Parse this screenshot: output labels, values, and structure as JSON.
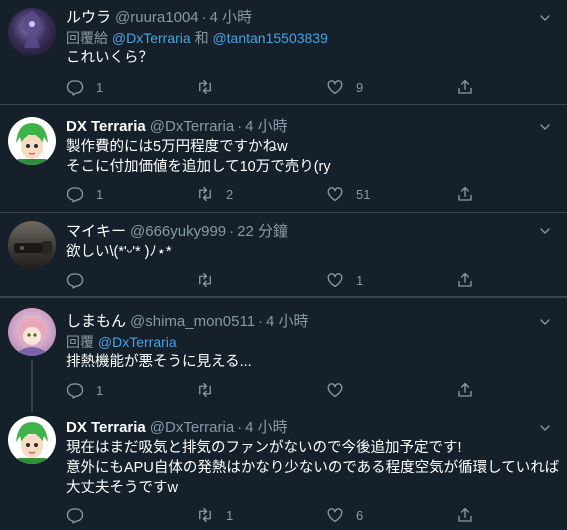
{
  "tweets": [
    {
      "name": "ルウラ",
      "handle": "@ruura1004",
      "sep": "·",
      "time": "4 小時",
      "reply_prefix": "回覆給",
      "reply_user1": "@DxTerraria",
      "reply_and": "和",
      "reply_user2": "@tantan15503839",
      "lines": [
        "これいくら？"
      ],
      "replies": "1",
      "retweets": "",
      "likes": "9"
    },
    {
      "name": "DX Terraria",
      "handle": "@DxTerraria",
      "sep": "·",
      "time": "4 小時",
      "lines": [
        "製作費的には5万円程度ですかねw",
        "そこに付加価値を追加して10万で売り(ry"
      ],
      "replies": "1",
      "retweets": "2",
      "likes": "51"
    },
    {
      "name": "マイキー",
      "handle": "@666yuky999",
      "sep": "·",
      "time": "22 分鐘",
      "lines": [
        "欲しい\\(*'ᵕ'* )ﾉ⋆*"
      ],
      "replies": "",
      "retweets": "",
      "likes": "1"
    },
    {
      "name": "しまもん",
      "handle": "@shima_mon0511",
      "sep": "·",
      "time": "4 小時",
      "reply_prefix": "回覆",
      "reply_user1": "@DxTerraria",
      "lines": [
        "排熱機能が悪そうに見える..."
      ],
      "replies": "1",
      "retweets": "",
      "likes": ""
    },
    {
      "name": "DX Terraria",
      "handle": "@DxTerraria",
      "sep": "·",
      "time": "4 小時",
      "lines": [
        "現在はまだ吸気と排気のファンがないので今後追加予定です!",
        "意外にもAPU自体の発熱はかなり少ないのである程度空気が循環していれば",
        "大丈夫そうですw"
      ],
      "replies": "",
      "retweets": "1",
      "likes": "6"
    }
  ],
  "icons": {
    "reply": "reply-icon",
    "retweet": "retweet-icon",
    "like": "heart-icon",
    "share": "share-icon",
    "menu": "chevron-down-icon"
  },
  "colors": {
    "background": "#15202b",
    "link": "#4aa3df",
    "muted": "#8899a6",
    "divider": "#38444d"
  }
}
